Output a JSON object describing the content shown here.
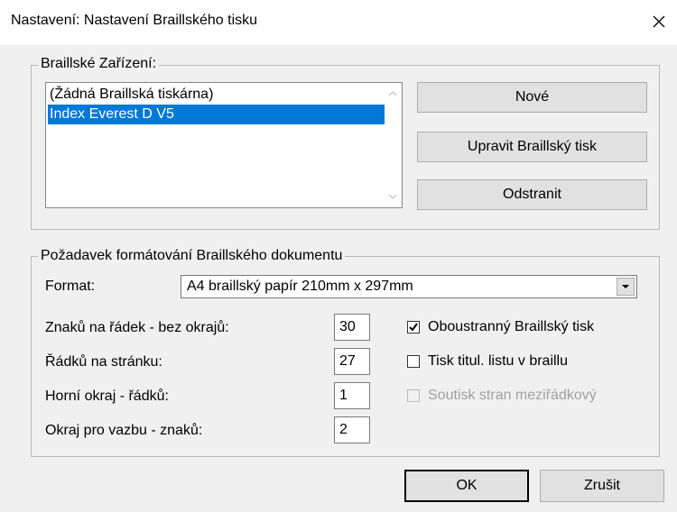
{
  "window": {
    "title": "Nastavení: Nastavení Braillského tisku",
    "close_icon": "close-icon"
  },
  "devices_group": {
    "legend": "Braillské Zařízení:",
    "items": [
      "(Žádná Braillská tiskárna)",
      "Index Everest D V5"
    ],
    "selected_index": 1,
    "buttons": {
      "new": "Nové",
      "edit": "Upravit Braillský tisk",
      "remove": "Odstranit"
    }
  },
  "format_group": {
    "legend": "Požadavek formátování Braillského dokumentu",
    "format_label": "Format:",
    "format_value": "A4 braillský papír 210mm x 297mm",
    "fields": [
      {
        "label": "Znaků na řádek - bez okrajů:",
        "value": "30"
      },
      {
        "label": "Řádků na stránku:",
        "value": "27"
      },
      {
        "label": "Horní okraj - řádků:",
        "value": "1"
      },
      {
        "label": "Okraj pro vazbu - znaků:",
        "value": "2"
      }
    ],
    "checkboxes": [
      {
        "label": "Oboustranný  Braillský tisk",
        "checked": true,
        "enabled": true
      },
      {
        "label": "Tisk titul. listu v braillu",
        "checked": false,
        "enabled": true
      },
      {
        "label": "Soutisk stran meziřádkový",
        "checked": false,
        "enabled": false
      }
    ]
  },
  "footer": {
    "ok": "OK",
    "cancel": "Zrušit"
  },
  "colors": {
    "selection": "#0078d7",
    "dialog_bg": "#f0f0f0",
    "disabled_text": "#a0a0a0"
  }
}
